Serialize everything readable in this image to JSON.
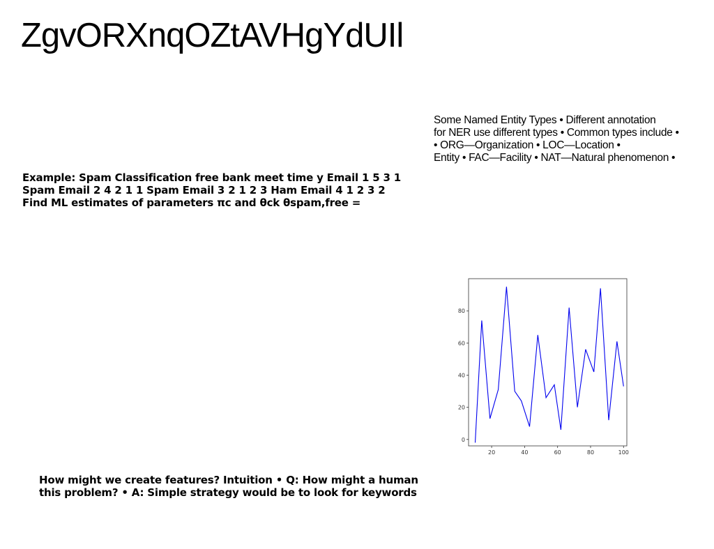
{
  "slide": {
    "title": "ZgvORXnqOZtAVHgYdUIl"
  },
  "ner_text": {
    "lines": [
      "Some Named Entity Types • Different annotation",
      "for NER use different types • Common types include •",
      "• ORG—Organization • LOC—Location •",
      "Entity • FAC—Facility • NAT—Natural phenomenon •"
    ]
  },
  "spam_text": {
    "lines": [
      "Example: Spam Classification free bank meet time y Email 1 5 3 1",
      "Spam Email 2 4 2 1 1 Spam Email 3 2 1 2 3 Ham Email 4 1 2 3 2",
      "Find ML estimates of parameters πc and θck θspam,free ="
    ]
  },
  "features_text": {
    "lines": [
      "How might we create features? Intuition • Q: How might a human",
      "this problem? • A: Simple strategy would be to look for keywords"
    ]
  },
  "chart_data": {
    "type": "line",
    "x": [
      10,
      14,
      19,
      24,
      29,
      34,
      38,
      43,
      48,
      53,
      58,
      62,
      67,
      72,
      77,
      82,
      86,
      91,
      96,
      100
    ],
    "series": [
      {
        "values": [
          -2,
          74,
          13,
          31,
          95,
          30,
          24,
          8,
          65,
          26,
          34,
          6,
          82,
          20,
          56,
          42,
          94,
          12,
          61,
          33
        ],
        "color": "#0000ee"
      }
    ],
    "xlim": [
      6,
      102
    ],
    "ylim": [
      -4,
      100
    ],
    "xticks": [
      20,
      40,
      60,
      80,
      100
    ],
    "yticks": [
      0,
      20,
      40,
      60,
      80
    ],
    "title": "",
    "xlabel": "",
    "ylabel": "",
    "grid": false
  }
}
